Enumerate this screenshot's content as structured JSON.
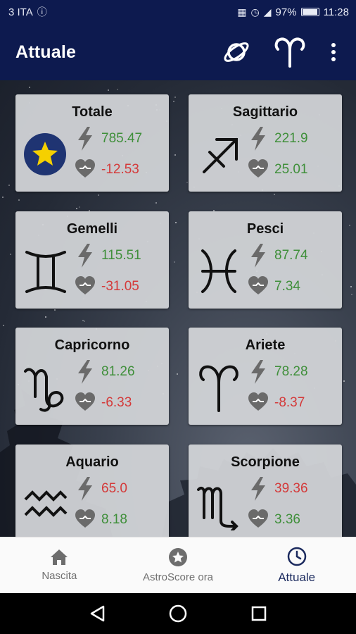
{
  "status_bar": {
    "carrier": "3 ITA",
    "battery": "97%",
    "time": "11:28"
  },
  "app_bar": {
    "title": "Attuale",
    "action_icons": [
      "planet-icon",
      "aries-sign-icon",
      "more-vert-icon"
    ]
  },
  "cards": [
    {
      "name": "Totale",
      "icon": "star-badge-icon",
      "energy": "785.47",
      "harmony": "-12.53",
      "energy_positive": true,
      "harmony_positive": false
    },
    {
      "name": "Sagittario",
      "icon": "sagittarius-icon",
      "energy": "221.9",
      "harmony": "25.01",
      "energy_positive": true,
      "harmony_positive": true
    },
    {
      "name": "Gemelli",
      "icon": "gemini-icon",
      "energy": "115.51",
      "harmony": "-31.05",
      "energy_positive": true,
      "harmony_positive": false
    },
    {
      "name": "Pesci",
      "icon": "pisces-icon",
      "energy": "87.74",
      "harmony": "7.34",
      "energy_positive": true,
      "harmony_positive": true
    },
    {
      "name": "Capricorno",
      "icon": "capricorn-icon",
      "energy": "81.26",
      "harmony": "-6.33",
      "energy_positive": true,
      "harmony_positive": false
    },
    {
      "name": "Ariete",
      "icon": "aries-icon",
      "energy": "78.28",
      "harmony": "-8.37",
      "energy_positive": true,
      "harmony_positive": false
    },
    {
      "name": "Aquario",
      "icon": "aquarius-icon",
      "energy": "65.0",
      "harmony": "8.18",
      "energy_positive": false,
      "harmony_positive": true
    },
    {
      "name": "Scorpione",
      "icon": "scorpio-icon",
      "energy": "39.36",
      "harmony": "3.36",
      "energy_positive": false,
      "harmony_positive": true
    }
  ],
  "colors": {
    "app_bar": "#0d1a4f",
    "positive": "#3f8f3a",
    "negative": "#d43a3a",
    "nav_active": "#1b2a5e"
  },
  "bottom_nav": {
    "items": [
      {
        "label": "Nascita",
        "icon": "home-icon"
      },
      {
        "label": "AstroScore ora",
        "icon": "star-circle-icon"
      },
      {
        "label": "Attuale",
        "icon": "clock-icon",
        "active": true
      }
    ]
  }
}
